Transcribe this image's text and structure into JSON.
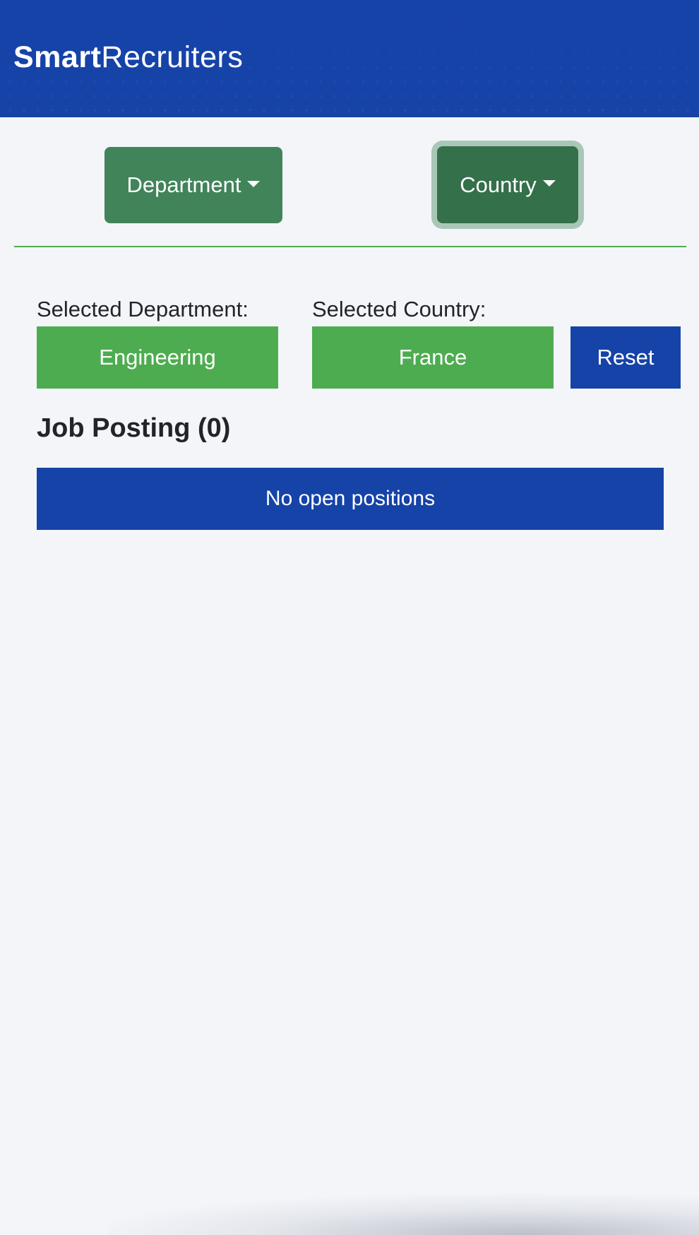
{
  "header": {
    "logo_strong": "Smart",
    "logo_light": "Recruiters"
  },
  "filters": {
    "department_button": "Department",
    "country_button": "Country",
    "selected_department_label": "Selected Department:",
    "selected_department_value": "Engineering",
    "selected_country_label": "Selected Country:",
    "selected_country_value": "France",
    "reset_button": "Reset"
  },
  "jobs": {
    "title": "Job Posting (0)",
    "empty_message": "No open positions"
  },
  "colors": {
    "brand_blue": "#1643a8",
    "green": "#4eac50",
    "dropdown_green": "#41845a",
    "dropdown_green_active": "#34704a",
    "background": "#f3f5f9"
  },
  "icons": {
    "dropdown_caret": "caret-down-icon"
  }
}
